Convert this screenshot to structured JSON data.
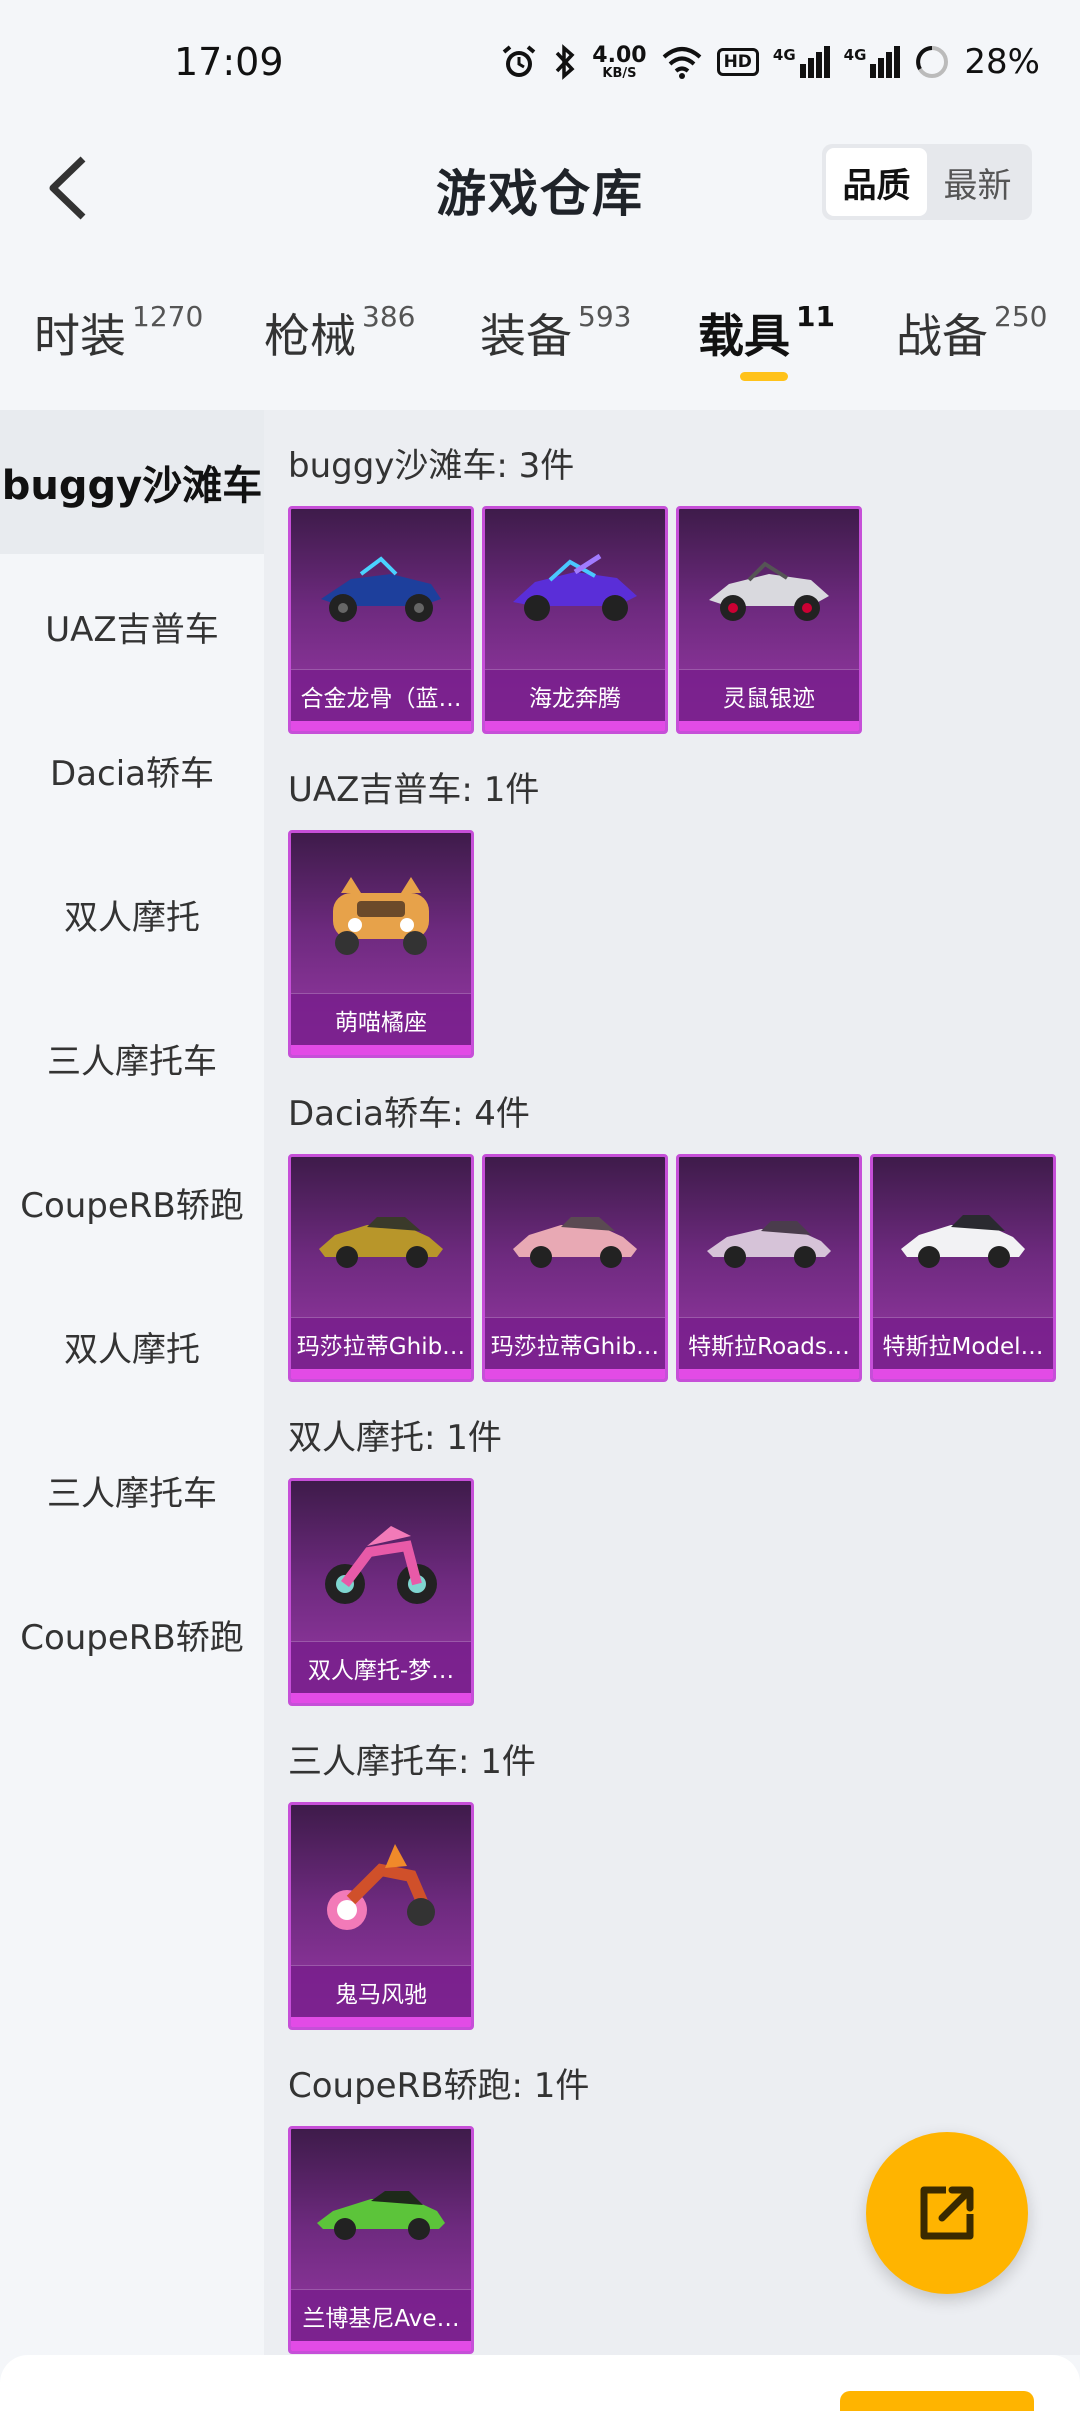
{
  "status_bar": {
    "time": "17:09",
    "net_speed_value": "4.00",
    "net_speed_unit": "KB/S",
    "hd_badge": "HD",
    "sig1_label": "4G",
    "sig2_label": "4G",
    "battery": "28%"
  },
  "header": {
    "title": "游戏仓库",
    "sort_quality": "品质",
    "sort_latest": "最新"
  },
  "tabs": [
    {
      "label": "时装",
      "count": "1270"
    },
    {
      "label": "枪械",
      "count": "386"
    },
    {
      "label": "装备",
      "count": "593"
    },
    {
      "label": "载具",
      "count": "11"
    },
    {
      "label": "战备",
      "count": "250"
    }
  ],
  "sidebar": [
    "buggy沙滩车",
    "UAZ吉普车",
    "Dacia轿车",
    "双人摩托",
    "三人摩托车",
    "CoupeRB轿跑",
    "双人摩托",
    "三人摩托车",
    "CoupeRB轿跑"
  ],
  "sections": [
    {
      "title": "buggy沙滩车: 3件",
      "items": [
        "合金龙骨（蓝…",
        "海龙奔腾",
        "灵鼠银迹"
      ]
    },
    {
      "title": "UAZ吉普车: 1件",
      "items": [
        "萌喵橘座"
      ]
    },
    {
      "title": "Dacia轿车: 4件",
      "items": [
        "玛莎拉蒂Ghib…",
        "玛莎拉蒂Ghib…",
        "特斯拉Roads…",
        "特斯拉Model…"
      ]
    },
    {
      "title": "双人摩托: 1件",
      "items": [
        "双人摩托-梦…"
      ]
    },
    {
      "title": "三人摩托车: 1件",
      "items": [
        "鬼马风驰"
      ]
    },
    {
      "title": "CoupeRB轿跑: 1件",
      "items": [
        "兰博基尼Ave…"
      ]
    }
  ],
  "colors": {
    "accent": "#ffc21a",
    "fab": "#ffb400",
    "card_top": "#3e1b4a",
    "card_bottom": "#9b3aa8",
    "card_border": "#c64fd8"
  },
  "icons": {
    "back": "chevron-left-icon",
    "fab": "share-icon",
    "status": [
      "alarm-icon",
      "bluetooth-icon",
      "wifi-icon",
      "signal-icon",
      "battery-icon"
    ]
  }
}
